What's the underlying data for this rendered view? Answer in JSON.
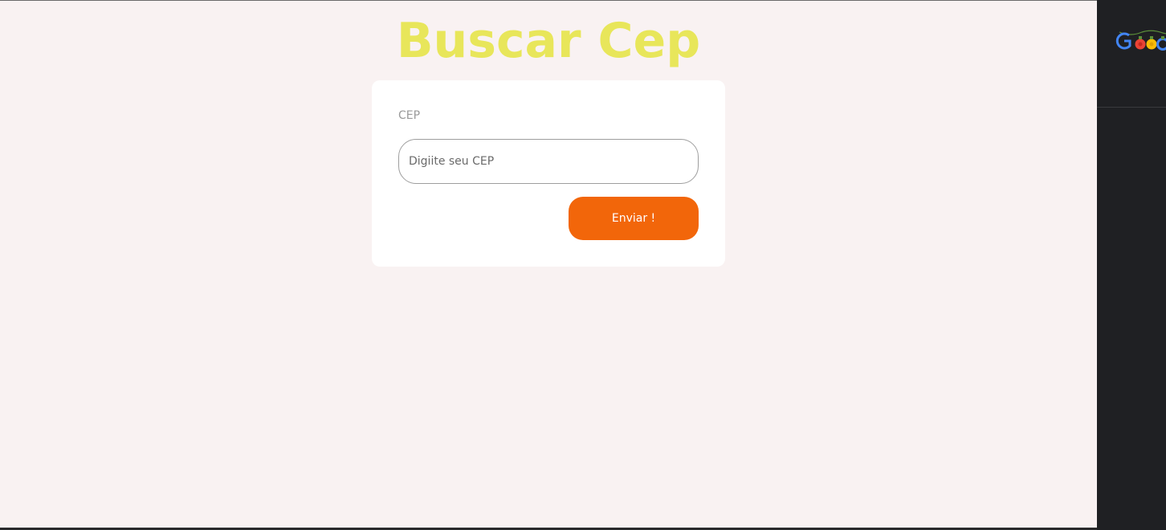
{
  "page": {
    "title": "Buscar Cep"
  },
  "form": {
    "cep_label": "CEP",
    "cep_placeholder": "Digiite seu CEP",
    "cep_value": "",
    "submit_label": "Enviar !"
  },
  "side_panel": {
    "logo_icon": "google-doodle-logo"
  },
  "colors": {
    "page_background": "#f9f2f2",
    "title": "#e8e65a",
    "button": "#f2660a",
    "side_panel": "#1f2023"
  }
}
